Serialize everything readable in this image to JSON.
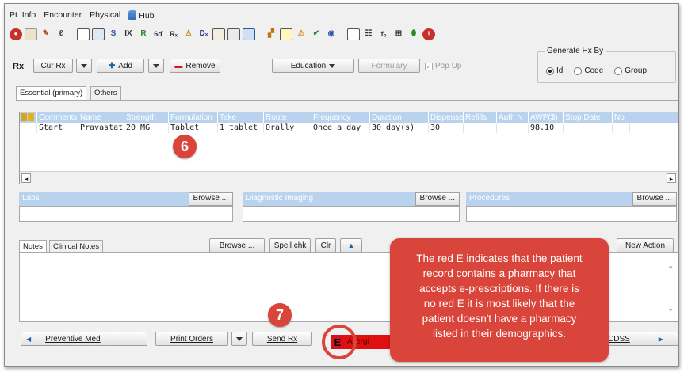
{
  "menu": [
    "Pt. Info",
    "Encounter",
    "Physical",
    "Hub"
  ],
  "toolbar_icons": [
    "stop-icon",
    "copy-icon",
    "pen-icon",
    "edit-icon",
    "document-icon",
    "calendar-icon",
    "s-icon",
    "ix-icon",
    "r-icon",
    "chart-icon",
    "rx-icon",
    "person-icon",
    "dx-icon",
    "building-icon",
    "list-icon",
    "monitor-icon",
    "book-icon",
    "notes-icon",
    "warning-icon",
    "check-icon",
    "globe-icon",
    "grid-icon",
    "tree-icon",
    "fx-icon",
    "stack-icon",
    "pill-icon",
    "alert-icon"
  ],
  "rx": {
    "label": "Rx",
    "cur_rx": "Cur Rx",
    "add": "Add",
    "remove": "Remove",
    "education": "Education",
    "formulary": "Formulary",
    "popup": "Pop Up"
  },
  "generate": {
    "title": "Generate Hx By",
    "options": [
      "Id",
      "Code",
      "Group"
    ],
    "selected": "Id"
  },
  "tabs": [
    "Essential (primary)",
    "Others"
  ],
  "grid": {
    "headers": [
      "Comments",
      "Name",
      "Strength",
      "Formulation",
      "Take",
      "Route",
      "Frequency",
      "Duration",
      "Dispense",
      "Refills",
      "Auth N",
      "AWP($)",
      "Stop Date",
      "No"
    ],
    "row": [
      "Start",
      "Pravastatin",
      "20 MG",
      "Tablet",
      "1 tablet",
      "Orally",
      "Once a day",
      "30 day(s)",
      "30",
      "",
      "",
      "98.10",
      "",
      ""
    ]
  },
  "panels": {
    "labs": "Labs",
    "diag": "Diagnostic Imaging",
    "proc": "Procedures",
    "browse": "Browse ..."
  },
  "notes": {
    "tab1": "Notes",
    "tab2": "Clinical Notes",
    "browse": "Browse ...",
    "spell": "Spell chk",
    "clr": "Clr",
    "new_action": "New Action"
  },
  "bottom": {
    "preventive": "Preventive Med",
    "print": "Print Orders",
    "send": "Send Rx",
    "e_label": "E",
    "allergy": "Allergi",
    "cdss": "CDSS"
  },
  "annotations": {
    "badge6": "6",
    "badge7": "7",
    "callout_lines": [
      "The red E indicates that the patient",
      "record contains a pharmacy that",
      "accepts e-prescriptions. If there is",
      "no red E it is most likely that the",
      "patient doesn't have a pharmacy",
      "listed in their demographics."
    ]
  },
  "colors": {
    "grid_header": "#b9d3ef",
    "badge": "#d9453a",
    "e_indicator": "#d9101a"
  }
}
